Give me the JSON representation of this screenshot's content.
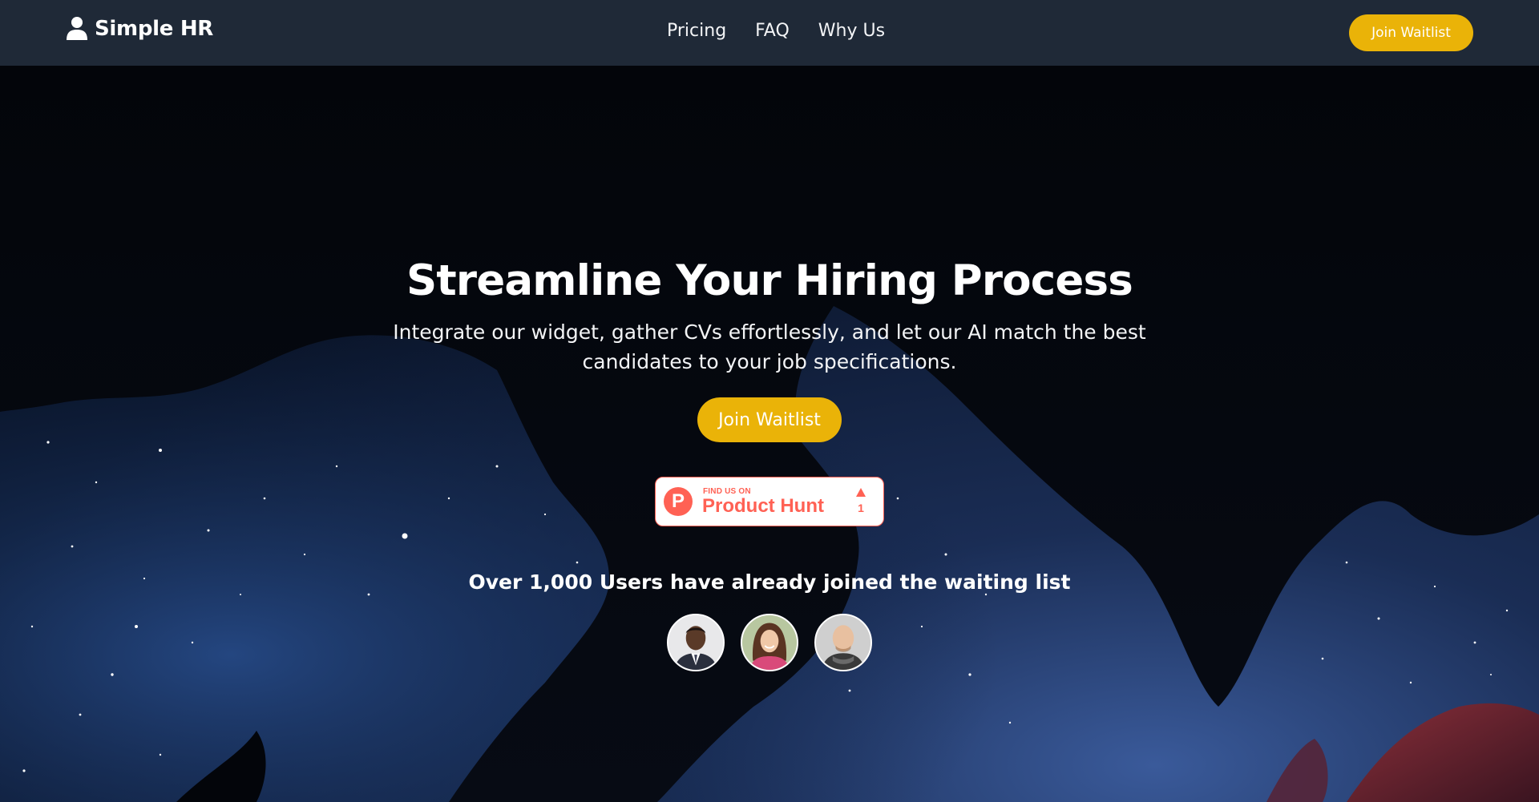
{
  "header": {
    "brand_name": "Simple HR",
    "brand_icon": "user-icon",
    "nav": [
      {
        "label": "Pricing"
      },
      {
        "label": "FAQ"
      },
      {
        "label": "Why Us"
      }
    ],
    "cta_label": "Join Waitlist"
  },
  "hero": {
    "headline": "Streamline Your Hiring Process",
    "subtitle": "Integrate our widget, gather CVs effortlessly, and let our AI match the best candidates to your job specifications.",
    "cta_label": "Join Waitlist",
    "product_hunt": {
      "small_text": "FIND US ON",
      "big_text": "Product Hunt",
      "logo_letter": "P",
      "upvotes": "1"
    },
    "social_proof": "Over 1,000 Users have already joined the waiting list",
    "avatars": [
      {
        "name": "avatar-man-suit"
      },
      {
        "name": "avatar-woman-smiling"
      },
      {
        "name": "avatar-man-bald"
      }
    ]
  },
  "colors": {
    "navbar_bg": "#1f2937",
    "accent": "#eab308",
    "product_hunt": "#ff6154"
  }
}
